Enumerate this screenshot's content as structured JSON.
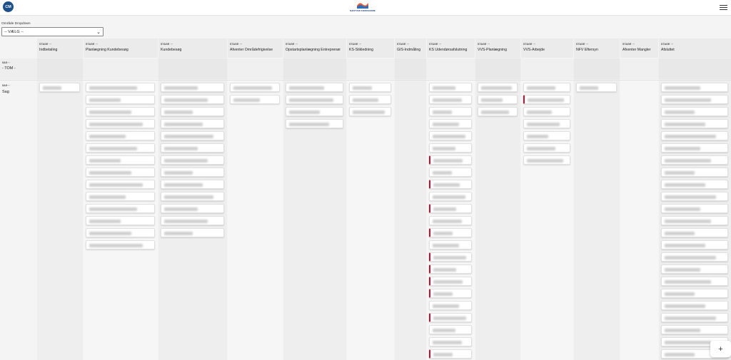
{
  "header": {
    "avatar_initials": "CM",
    "logo_text": "NÆSTVED FJERNVARME",
    "brand_colors": {
      "primary": "#1d3a6e",
      "accent": "#e85a3a",
      "avatar": "#1a4f8a"
    }
  },
  "filter": {
    "label": "Område Dropdown",
    "selected": "-- VÆLG --"
  },
  "stage_tag": "STAGE ···",
  "row_tag": "SAG ···",
  "stages": [
    {
      "name": "Indbetaling"
    },
    {
      "name": "Planlægning Kundebesøg"
    },
    {
      "name": "Kundebesøg"
    },
    {
      "name": "Afventer Områdefrigivelse"
    },
    {
      "name": "Opstartsplanlægning Entreprenør"
    },
    {
      "name": "KS-Stikledning"
    },
    {
      "name": "GIS-Indmåling"
    },
    {
      "name": "KS Udendørsafslutning"
    },
    {
      "name": "VVS-Planlægning"
    },
    {
      "name": "VVS-Arbejde"
    },
    {
      "name": "NFV Eftersyn"
    },
    {
      "name": "Afventer Mangler"
    },
    {
      "name": "Afsluttet"
    }
  ],
  "rows": [
    {
      "name": "- TOM -"
    },
    {
      "name": "Sag"
    }
  ],
  "fab": {
    "label": "+"
  },
  "status_colors": {
    "flagged": "#c8102e"
  }
}
